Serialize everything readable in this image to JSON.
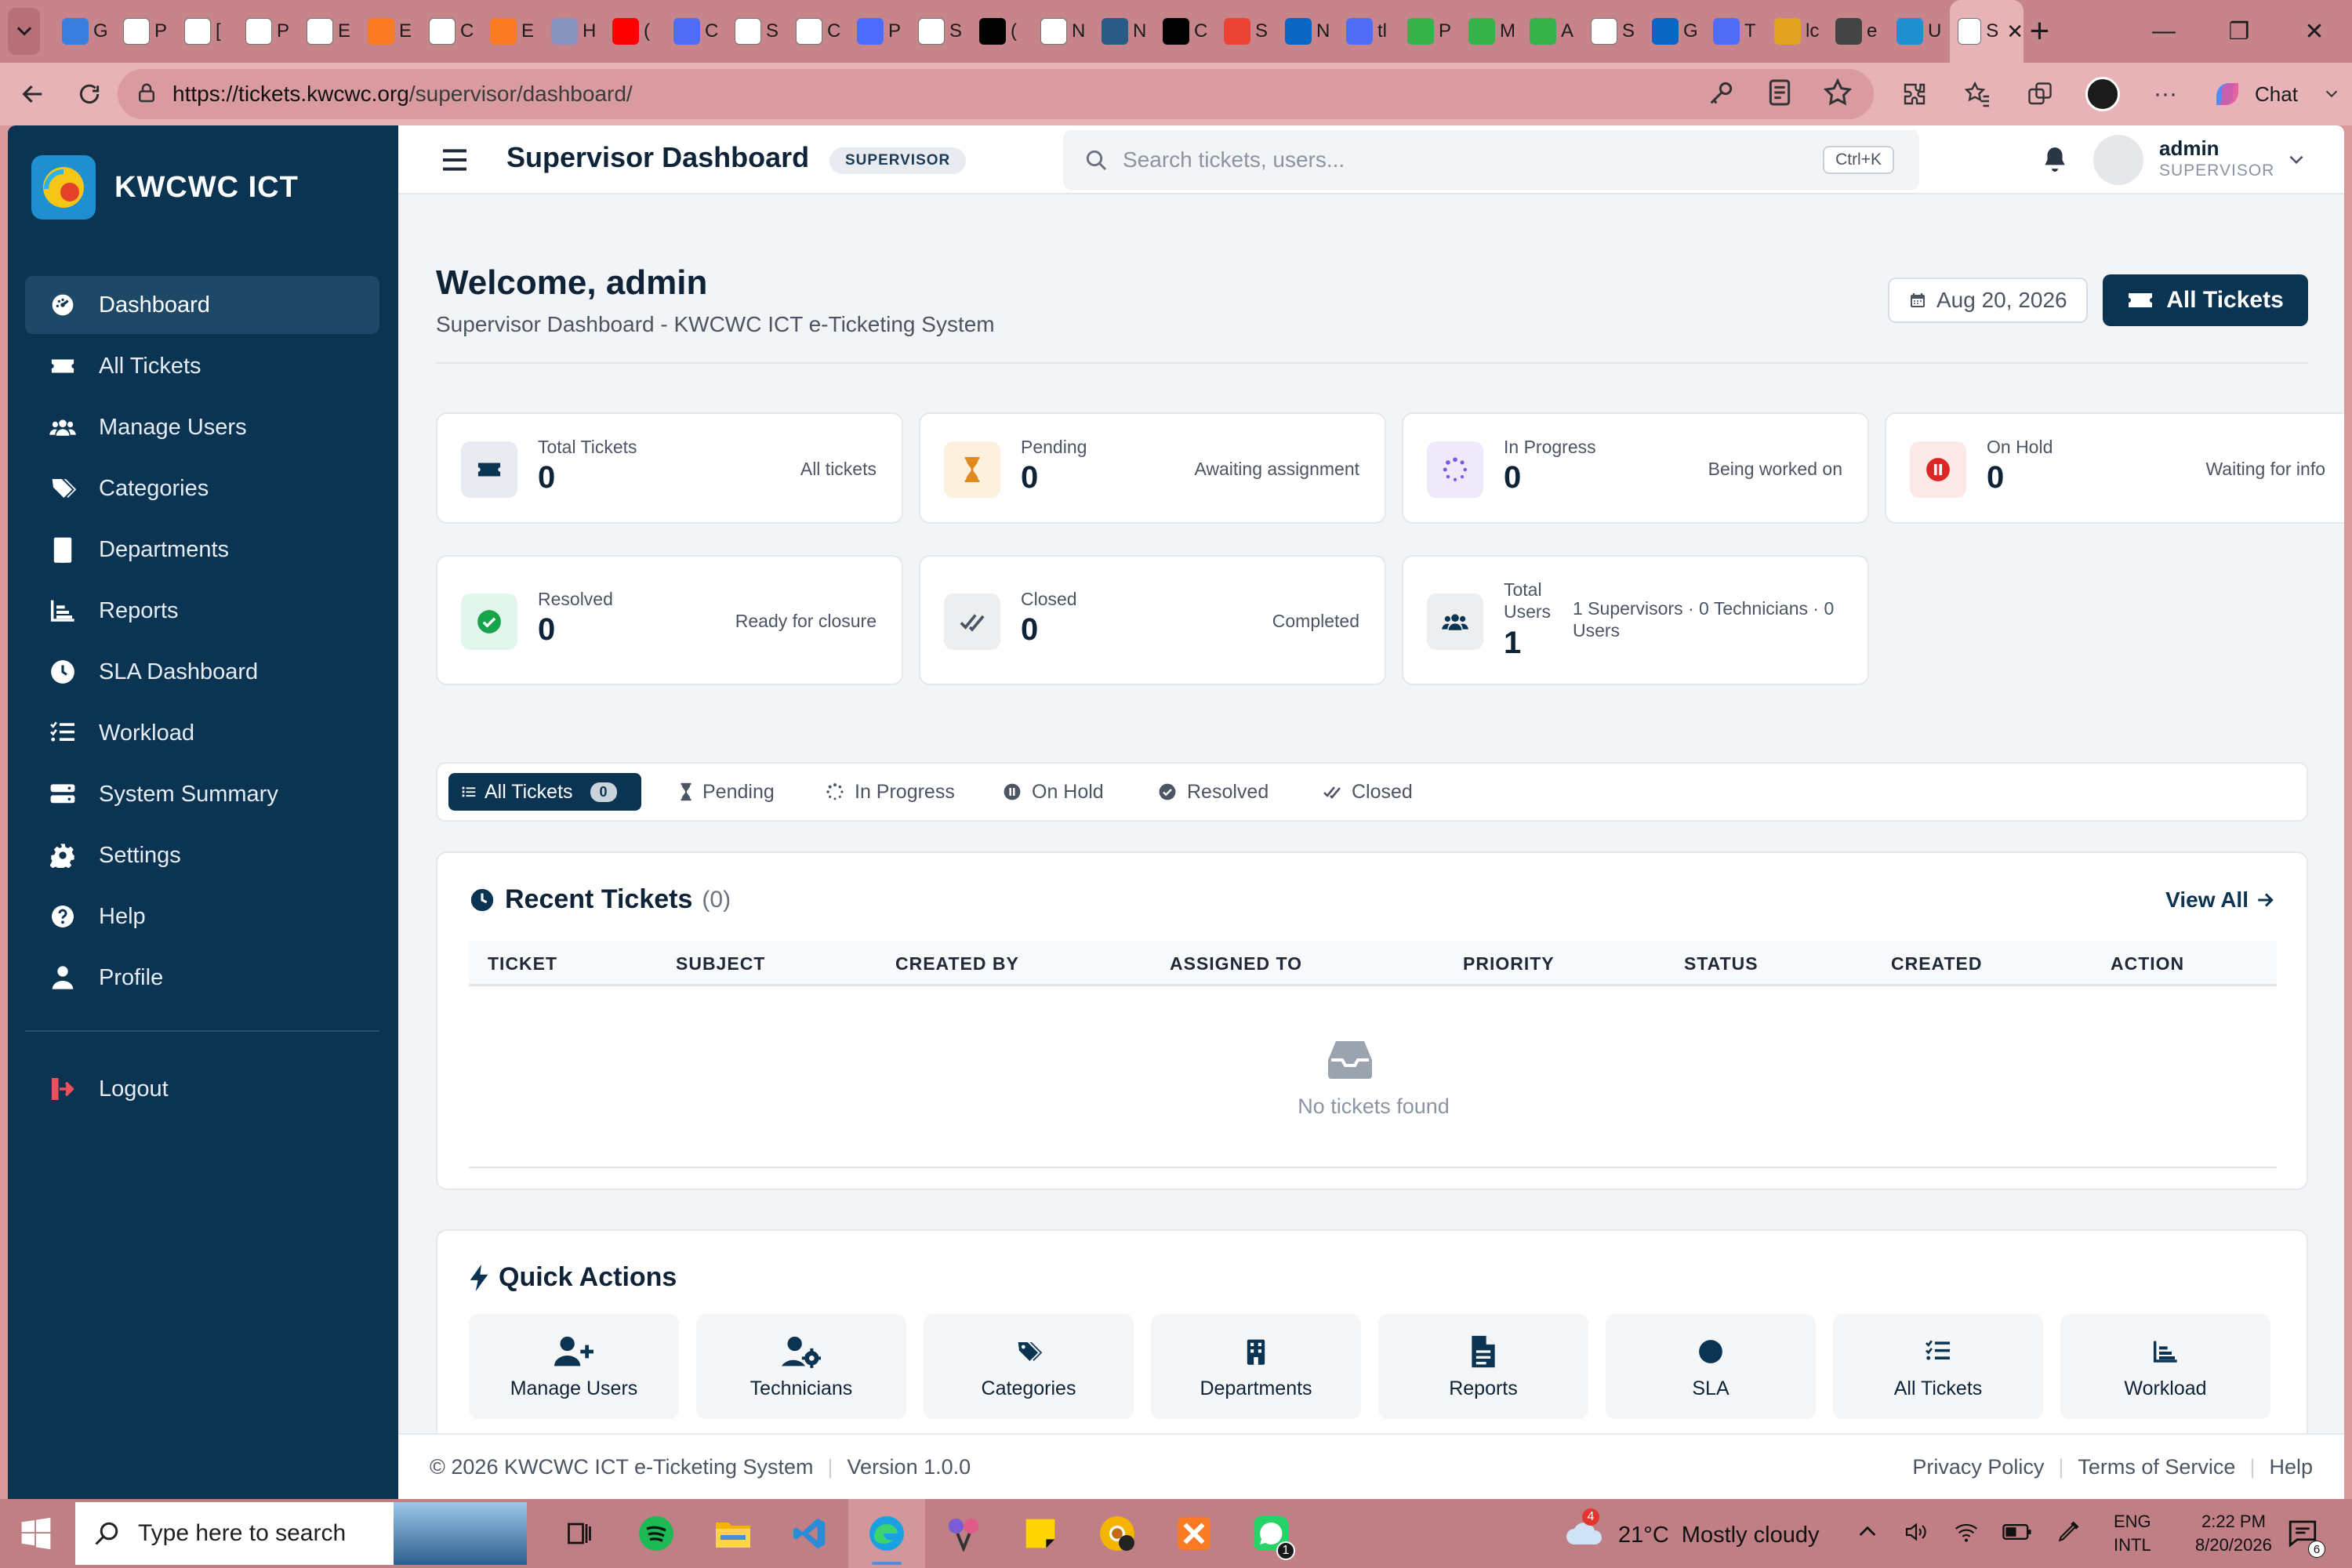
{
  "browser": {
    "tabs": [
      {
        "icon": "google-classroom-icon",
        "label": "Gr",
        "color": "#3b7ddd"
      },
      {
        "icon": "page-icon",
        "label": "P",
        "color": "#ffffff"
      },
      {
        "icon": "wordpress-icon",
        "label": "[",
        "color": "#ffffff"
      },
      {
        "icon": "page-icon",
        "label": "P",
        "color": "#ffffff"
      },
      {
        "icon": "page-icon",
        "label": "E",
        "color": "#ffffff"
      },
      {
        "icon": "xampp-icon",
        "label": "E",
        "color": "#fb7a24"
      },
      {
        "icon": "page-icon",
        "label": "C",
        "color": "#ffffff"
      },
      {
        "icon": "xampp-icon",
        "label": "E",
        "color": "#fb7a24"
      },
      {
        "icon": "php-icon",
        "label": "H",
        "color": "#8892bf"
      },
      {
        "icon": "youtube-icon",
        "label": "(",
        "color": "#ff0000"
      },
      {
        "icon": "copilot-icon",
        "label": "C",
        "color": "#4f6cf6"
      },
      {
        "icon": "page-icon",
        "label": "S",
        "color": "#ffffff"
      },
      {
        "icon": "openai-icon",
        "label": "C",
        "color": "#ffffff"
      },
      {
        "icon": "deepseek-icon",
        "label": "P",
        "color": "#4d6bfe"
      },
      {
        "icon": "page-icon",
        "label": "S",
        "color": "#ffffff"
      },
      {
        "icon": "x-icon",
        "label": "(",
        "color": "#000000"
      },
      {
        "icon": "calendar-icon",
        "label": "N",
        "color": "#ffffff"
      },
      {
        "icon": "user-icon",
        "label": "N",
        "color": "#2a5b86"
      },
      {
        "icon": "sparkle-icon",
        "label": "C",
        "color": "#000000"
      },
      {
        "icon": "gmail-icon",
        "label": "S",
        "color": "#ea4335"
      },
      {
        "icon": "linkedin-icon",
        "label": "N",
        "color": "#0a66c2"
      },
      {
        "icon": "search-icon",
        "label": "tl",
        "color": "#4f6cf6"
      },
      {
        "icon": "feather-icon",
        "label": "P",
        "color": "#35b34a"
      },
      {
        "icon": "feather-icon",
        "label": "M",
        "color": "#35b34a"
      },
      {
        "icon": "feather-icon",
        "label": "A",
        "color": "#35b34a"
      },
      {
        "icon": "page-icon",
        "label": "S",
        "color": "#ffffff"
      },
      {
        "icon": "linkedin-icon",
        "label": "G",
        "color": "#0a66c2"
      },
      {
        "icon": "pulse-icon",
        "label": "T",
        "color": "#4f6cf6"
      },
      {
        "icon": "grid-icon",
        "label": "lc",
        "color": "#e0a020"
      },
      {
        "icon": "doc-icon",
        "label": "e",
        "color": "#444444"
      },
      {
        "icon": "kwcwc-icon",
        "label": "U",
        "color": "#1f8fd0"
      },
      {
        "icon": "page-icon",
        "label": "S",
        "color": "#ffffff",
        "active": true
      }
    ],
    "url_host": "https://tickets.kwcwc.org",
    "url_path": "/supervisor/dashboard/",
    "chat_label": "Chat"
  },
  "sidebar": {
    "brand": "KWCWC ICT",
    "items": [
      {
        "label": "Dashboard",
        "icon": "gauge-icon",
        "active": true
      },
      {
        "label": "All Tickets",
        "icon": "ticket-icon"
      },
      {
        "label": "Manage Users",
        "icon": "users-icon"
      },
      {
        "label": "Categories",
        "icon": "tags-icon"
      },
      {
        "label": "Departments",
        "icon": "building-icon"
      },
      {
        "label": "Reports",
        "icon": "chart-icon"
      },
      {
        "label": "SLA Dashboard",
        "icon": "clock-icon"
      },
      {
        "label": "Workload",
        "icon": "list-check-icon"
      },
      {
        "label": "System Summary",
        "icon": "server-icon"
      },
      {
        "label": "Settings",
        "icon": "gear-icon"
      },
      {
        "label": "Help",
        "icon": "question-icon"
      },
      {
        "label": "Profile",
        "icon": "user-icon"
      }
    ],
    "logout": "Logout"
  },
  "topbar": {
    "title": "Supervisor Dashboard",
    "badge": "SUPERVISOR",
    "search_placeholder": "Search tickets, users...",
    "search_shortcut": "Ctrl+K",
    "user_name": "admin",
    "user_role": "SUPERVISOR"
  },
  "header": {
    "welcome": "Welcome, admin",
    "subtitle": "Supervisor Dashboard - KWCWC ICT e-Ticketing System",
    "date": "Aug 20, 2026",
    "all_tickets_button": "All Tickets"
  },
  "stats": [
    {
      "label": "Total Tickets",
      "value": "0",
      "note": "All tickets",
      "icon": "ticket-icon",
      "bg": "#e8ecf0",
      "fg": "#0b3352"
    },
    {
      "label": "Pending",
      "value": "0",
      "note": "Awaiting assignment",
      "icon": "hourglass-icon",
      "bg": "#fdf0df",
      "fg": "#e08a1e"
    },
    {
      "label": "In Progress",
      "value": "0",
      "note": "Being worked on",
      "icon": "spinner-icon",
      "bg": "#eeeafb",
      "fg": "#7c5ae0"
    },
    {
      "label": "On Hold",
      "value": "0",
      "note": "Waiting for info",
      "icon": "pause-icon",
      "bg": "#fde8e8",
      "fg": "#dc2626"
    },
    {
      "label": "Resolved",
      "value": "0",
      "note": "Ready for closure",
      "icon": "check-circle-icon",
      "bg": "#e3f6ed",
      "fg": "#16a34a"
    },
    {
      "label": "Closed",
      "value": "0",
      "note": "Completed",
      "icon": "double-check-icon",
      "bg": "#eceef0",
      "fg": "#4b5563"
    },
    {
      "label": "Total Users",
      "value": "1",
      "note": "1 Supervisors · 0 Technicians · 0 Users",
      "icon": "users-icon",
      "bg": "#eceef0",
      "fg": "#0b3352"
    }
  ],
  "filters": [
    {
      "label": "All Tickets",
      "count": "0",
      "icon": "list-icon",
      "active": true
    },
    {
      "label": "Pending",
      "icon": "hourglass-icon"
    },
    {
      "label": "In Progress",
      "icon": "spinner-icon"
    },
    {
      "label": "On Hold",
      "icon": "pause-icon"
    },
    {
      "label": "Resolved",
      "icon": "check-circle-icon"
    },
    {
      "label": "Closed",
      "icon": "double-check-icon"
    }
  ],
  "recent": {
    "title": "Recent Tickets",
    "count": "(0)",
    "view_all": "View All",
    "columns": [
      "TICKET",
      "SUBJECT",
      "CREATED BY",
      "ASSIGNED TO",
      "PRIORITY",
      "STATUS",
      "CREATED",
      "ACTION"
    ],
    "empty": "No tickets found"
  },
  "quick_actions": {
    "title": "Quick Actions",
    "items": [
      {
        "label": "Manage Users",
        "icon": "user-plus-icon"
      },
      {
        "label": "Technicians",
        "icon": "user-gear-icon"
      },
      {
        "label": "Categories",
        "icon": "tags-icon"
      },
      {
        "label": "Departments",
        "icon": "building-icon"
      },
      {
        "label": "Reports",
        "icon": "file-icon"
      },
      {
        "label": "SLA",
        "icon": "clock-icon"
      },
      {
        "label": "All Tickets",
        "icon": "list-check-icon"
      },
      {
        "label": "Workload",
        "icon": "chart-icon"
      }
    ]
  },
  "footer": {
    "copyright": "© 2026 KWCWC ICT e-Ticketing System",
    "version": "Version 1.0.0",
    "links": [
      "Privacy Policy",
      "Terms of Service",
      "Help"
    ]
  },
  "taskbar": {
    "search_placeholder": "Type here to search",
    "weather_temp": "21°C",
    "weather_desc": "Mostly cloudy",
    "weather_badge": "4",
    "lang_1": "ENG",
    "lang_2": "INTL",
    "time": "2:22 PM",
    "date": "8/20/2026",
    "notifications": "6",
    "whatsapp_badge": "1"
  }
}
